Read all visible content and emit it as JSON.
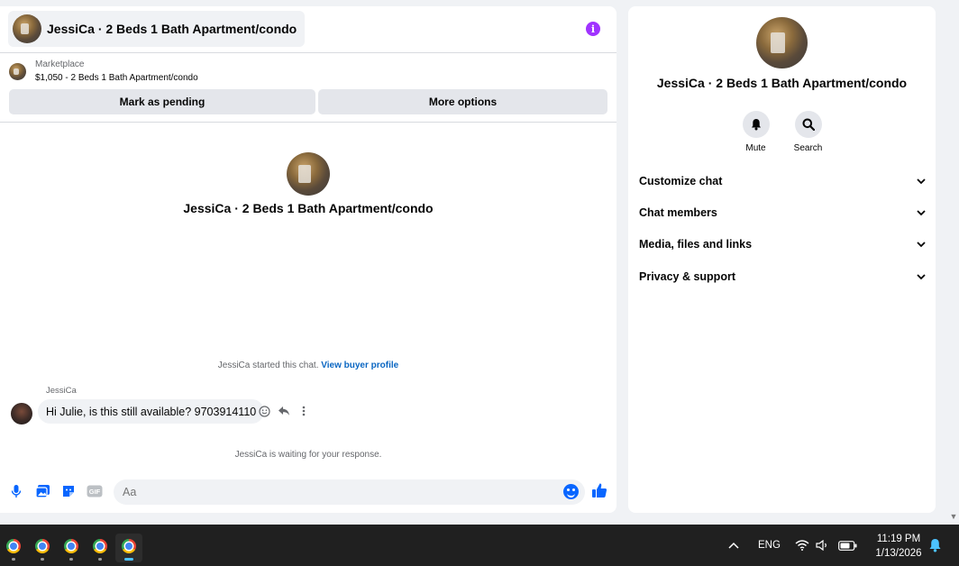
{
  "chat": {
    "title": "JessiCa · 2 Beds 1 Bath Apartment/condo",
    "marketplace_label": "Marketplace",
    "listing": "$1,050 - 2 Beds 1 Bath Apartment/condo",
    "mark_pending": "Mark as pending",
    "more_options": "More options",
    "profile_name": "JessiCa · 2 Beds 1 Bath Apartment/condo",
    "started_text": "JessiCa started this chat.",
    "view_profile": "View buyer profile",
    "sender": "JessiCa",
    "message": "Hi Julie, is this still available? 9703914110",
    "waiting_text": "JessiCa is waiting for your response.",
    "input_placeholder": "Aa"
  },
  "info": {
    "name": "JessiCa · 2 Beds 1 Bath Apartment/condo",
    "mute_label": "Mute",
    "search_label": "Search",
    "menu": [
      "Customize chat",
      "Chat members",
      "Media, files and links",
      "Privacy & support"
    ]
  },
  "taskbar": {
    "apps": [
      "chrome-icon",
      "chrome-icon",
      "chrome-icon",
      "chrome-icon",
      "chrome-icon"
    ],
    "language": "ENG",
    "time": "11:19 PM",
    "date": "1/13/2026"
  },
  "colors": {
    "accent": "#0866ff",
    "info_purple": "#a033ff",
    "link": "#0a66c2"
  }
}
